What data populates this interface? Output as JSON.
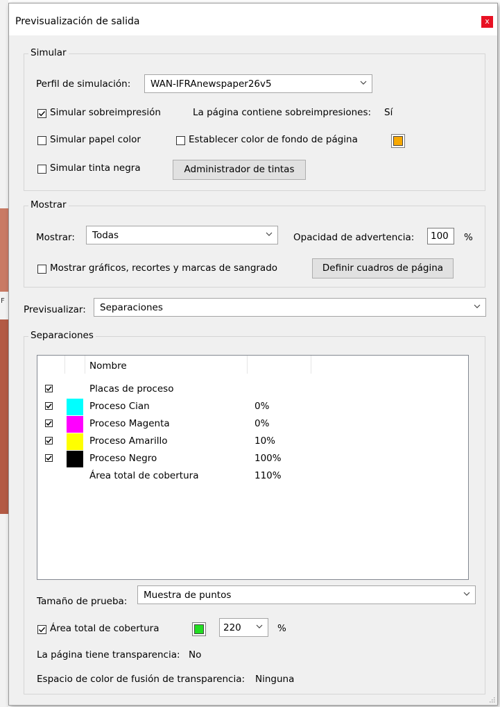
{
  "window": {
    "title": "Previsualización de salida",
    "close_glyph": "x"
  },
  "background": {
    "peek_text": "F"
  },
  "simular": {
    "legend": "Simular",
    "perfil_label": "Perfil de simulación:",
    "perfil_value": "WAN-IFRAnewspaper26v5",
    "sobreimpresion": {
      "label": "Simular sobreimpresión",
      "checked": true
    },
    "contiene_label": "La página contiene sobreimpresiones:",
    "contiene_value": "Sí",
    "papel_color": {
      "label": "Simular papel color",
      "checked": false
    },
    "fondo_pagina": {
      "label": "Establecer color de fondo de página",
      "checked": false,
      "color": "#f7a800"
    },
    "tinta_negra": {
      "label": "Simular tinta negra",
      "checked": false
    },
    "administrador_button": "Administrador de tintas"
  },
  "mostrar": {
    "legend": "Mostrar",
    "mostrar_label": "Mostrar:",
    "mostrar_value": "Todas",
    "opacidad_label": "Opacidad de advertencia:",
    "opacidad_value": "100",
    "opacidad_unit": "%",
    "graficos": {
      "label": "Mostrar gráficos, recortes y marcas de sangrado",
      "checked": false
    },
    "definir_button": "Definir cuadros de página"
  },
  "previsualizar": {
    "label": "Previsualizar:",
    "value": "Separaciones"
  },
  "separaciones": {
    "legend": "Separaciones",
    "columns": [
      "Nombre",
      "",
      ""
    ],
    "rows": [
      {
        "checked": true,
        "swatch": "",
        "name": "Placas de proceso",
        "percent": ""
      },
      {
        "checked": true,
        "swatch": "#00ffff",
        "name": "Proceso Cian",
        "percent": "0%"
      },
      {
        "checked": true,
        "swatch": "#ff00ff",
        "name": "Proceso Magenta",
        "percent": "0%"
      },
      {
        "checked": true,
        "swatch": "#ffff00",
        "name": "Proceso Amarillo",
        "percent": "10%"
      },
      {
        "checked": true,
        "swatch": "#000000",
        "name": "Proceso Negro",
        "percent": "100%"
      },
      {
        "checked": null,
        "swatch": "",
        "name": "Área total de cobertura",
        "percent": "110%"
      }
    ],
    "tamano_label": "Tamaño de prueba:",
    "tamano_value": "Muestra de puntos",
    "area_total": {
      "label": "Área total de cobertura",
      "checked": true,
      "color": "#22dd22"
    },
    "area_value": "220",
    "area_unit": "%",
    "transparencia_label": "La página tiene transparencia:",
    "transparencia_value": "No",
    "espacio_label": "Espacio de color de fusión de transparencia:",
    "espacio_value": "Ninguna"
  }
}
